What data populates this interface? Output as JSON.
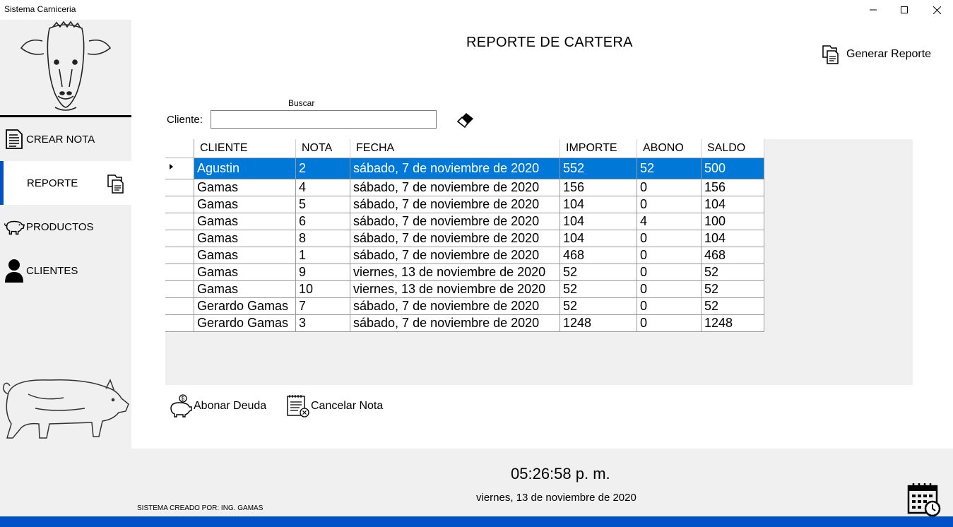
{
  "window": {
    "title": "Sistema Carniceria",
    "controls": {
      "minimize": "—",
      "maximize": "☐",
      "close": "✕"
    }
  },
  "sidebar": {
    "items": [
      {
        "label": "CREAR NOTA",
        "icon": "document-icon"
      },
      {
        "label": "REPORTE",
        "icon": "report-files-icon",
        "active": true
      },
      {
        "label": "PRODUCTOS",
        "icon": "pig-icon"
      },
      {
        "label": "CLIENTES",
        "icon": "user-icon"
      }
    ]
  },
  "main": {
    "title": "REPORTE DE CARTERA",
    "generate_button": "Generar Reporte",
    "search": {
      "caption": "Buscar",
      "label": "Cliente:",
      "value": "",
      "placeholder": ""
    },
    "table": {
      "columns": [
        "CLIENTE",
        "NOTA",
        "FECHA",
        "IMPORTE",
        "ABONO",
        "SALDO"
      ],
      "rows": [
        [
          "Agustin",
          "2",
          "sábado, 7 de noviembre de 2020",
          "552",
          "52",
          "500"
        ],
        [
          "Gamas",
          "4",
          "sábado, 7 de noviembre de 2020",
          "156",
          "0",
          "156"
        ],
        [
          "Gamas",
          "5",
          "sábado, 7 de noviembre de 2020",
          "104",
          "0",
          "104"
        ],
        [
          "Gamas",
          "6",
          "sábado, 7 de noviembre de 2020",
          "104",
          "4",
          "100"
        ],
        [
          "Gamas",
          "8",
          "sábado, 7 de noviembre de 2020",
          "104",
          "0",
          "104"
        ],
        [
          "Gamas",
          "1",
          "sábado, 7 de noviembre de 2020",
          "468",
          "0",
          "468"
        ],
        [
          "Gamas",
          "9",
          "viernes, 13 de noviembre de 2020",
          "52",
          "0",
          "52"
        ],
        [
          "Gamas",
          "10",
          "viernes, 13 de noviembre de 2020",
          "52",
          "0",
          "52"
        ],
        [
          "Gerardo Gamas",
          "7",
          "sábado, 7 de noviembre de 2020",
          "52",
          "0",
          "52"
        ],
        [
          "Gerardo Gamas",
          "3",
          "sábado, 7 de noviembre de 2020",
          "1248",
          "0",
          "1248"
        ]
      ],
      "selected_row": 0
    },
    "actions": {
      "abonar": "Abonar Deuda",
      "cancelar": "Cancelar Nota"
    }
  },
  "footer": {
    "time": "05:26:58 p. m.",
    "date": "viernes, 13 de noviembre de 2020",
    "credit": "SISTEMA CREADO POR: ING. GAMAS"
  },
  "colors": {
    "accent": "#0050c8",
    "selection": "#0078d7",
    "panel": "#f0f0f0"
  }
}
